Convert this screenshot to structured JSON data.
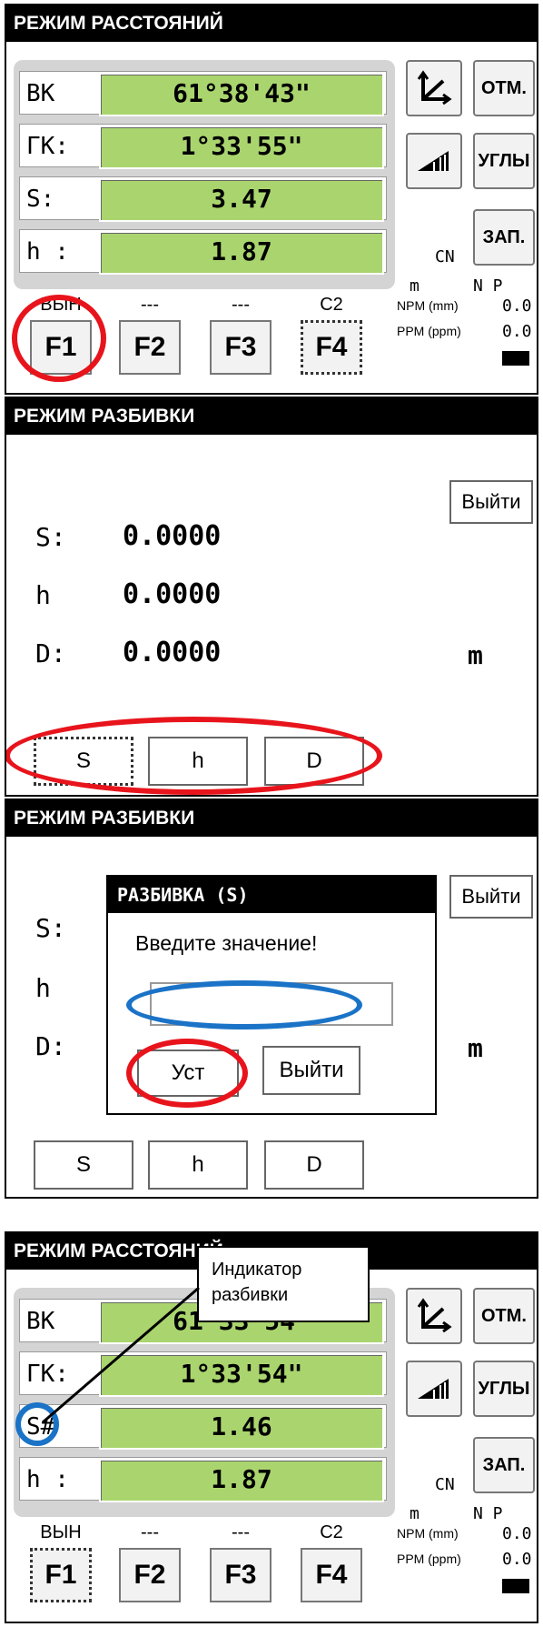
{
  "screen1": {
    "title": "РЕЖИМ РАССТОЯНИЙ",
    "rows": [
      {
        "label": "ВК",
        "value": "61°38'43\""
      },
      {
        "label": "ГК:",
        "value": "1°33'55\""
      },
      {
        "label": "S:",
        "value": "3.47"
      },
      {
        "label": "h :",
        "value": "1.87"
      }
    ],
    "side_buttons": {
      "axes_icon": "axes-icon",
      "otm": "ОТМ.",
      "slope_icon": "slope-icon",
      "ugly": "УГЛЫ",
      "zap": "ЗАП."
    },
    "cn": "CN",
    "unit_m": "m",
    "np": "N P",
    "npm_label": "NPM (mm)",
    "npm_value": "0.0",
    "ppm_label": "PPM (ppm)",
    "ppm_value": "0.0",
    "fkey_labels": [
      "ВЫН",
      "---",
      "---",
      "C2"
    ],
    "fkeys": [
      "F1",
      "F2",
      "F3",
      "F4"
    ]
  },
  "screen2": {
    "title": "РЕЖИМ РАЗБИВКИ",
    "exit": "Выйти",
    "rows": [
      {
        "label": "S:",
        "value": "0.0000"
      },
      {
        "label": "h",
        "value": "0.0000"
      },
      {
        "label": "D:",
        "value": "0.0000"
      }
    ],
    "unit": "m",
    "buttons": [
      "S",
      "h",
      "D"
    ]
  },
  "screen3": {
    "title": "РЕЖИМ РАЗБИВКИ",
    "exit": "Выйти",
    "labels": [
      "S:",
      "h",
      "D:"
    ],
    "unit": "m",
    "dialog": {
      "title": "РАЗБИВКА (S)",
      "prompt": "Введите значение!",
      "input_value": "",
      "ok": "Уст",
      "cancel": "Выйти"
    },
    "buttons": [
      "S",
      "h",
      "D"
    ]
  },
  "screen4": {
    "title": "РЕЖИМ РАССТОЯНИЙ",
    "callout": "Индикатор разбивки",
    "rows": [
      {
        "label": "ВК",
        "value": "61°33'54\""
      },
      {
        "label": "ГК:",
        "value": "1°33'54\""
      },
      {
        "label": "S#",
        "value": "1.46"
      },
      {
        "label": "h :",
        "value": "1.87"
      }
    ],
    "side_buttons": {
      "otm": "ОТМ.",
      "ugly": "УГЛЫ",
      "zap": "ЗАП."
    },
    "cn": "CN",
    "unit_m": "m",
    "np": "N P",
    "npm_label": "NPM (mm)",
    "npm_value": "0.0",
    "ppm_label": "PPM (ppm)",
    "ppm_value": "0.0",
    "fkey_labels": [
      "ВЫН",
      "---",
      "---",
      "C2"
    ],
    "fkeys": [
      "F1",
      "F2",
      "F3",
      "F4"
    ]
  },
  "colors": {
    "value_bg": "#aad56e",
    "highlight_red": "#e8141c",
    "highlight_blue": "#1a73c7"
  }
}
